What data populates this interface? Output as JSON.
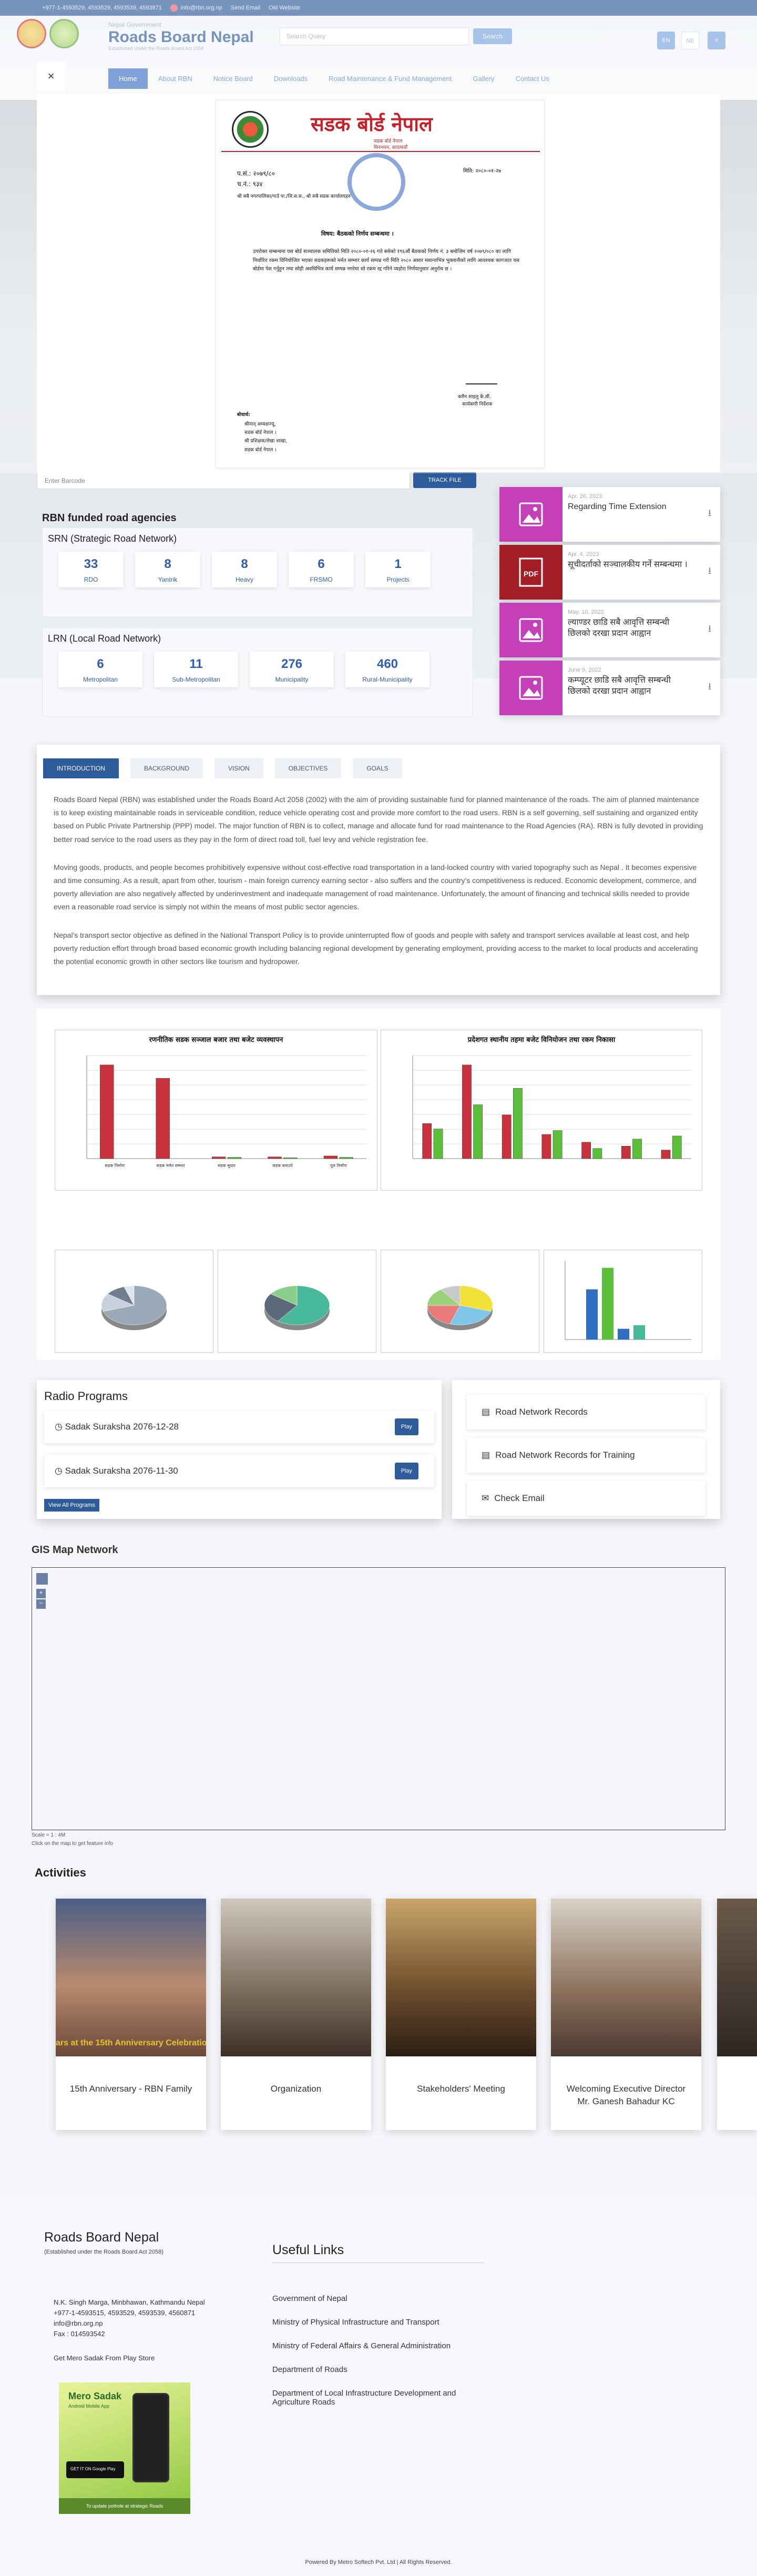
{
  "topbar": {
    "phones": "+977-1-4593529, 4593529, 4593539, 4593871",
    "email": "info@rbn.org.np",
    "links": [
      "Send Email",
      "Old Website"
    ]
  },
  "header": {
    "govt": "Nepal Government",
    "name": "Roads Board Nepal",
    "tagline": "Established Under the Roads Board Act 2058",
    "search_placeholder": "Search Query",
    "search_btn": "Search",
    "lang": [
      "EN",
      "NE"
    ],
    "nav": [
      "Home",
      "About RBN",
      "Notice Board",
      "Downloads",
      "Road Maintenance & Fund Management",
      "Gallery",
      "Contact Us"
    ]
  },
  "modal": {
    "close": "×",
    "letter": {
      "title": "सडक बोर्ड नेपाल",
      "subtitle": "सडक बोर्ड नेपाल",
      "address": "मिनभवन, काठमाडौं",
      "pa_sa": "प.सं.: २०७९/८०",
      "cha_no": "च.नं.: ९३४",
      "date": "मिति: २०८०-०१-२७",
      "to": "श्री सबै नगरपालिका/गाउँ पा./जि.स.स., श्री सबै सडक कार्यालयहरु",
      "subject": "विषय: बैठकको निर्णय सम्बन्धमा ।",
      "body": "उपरोक्त सम्बन्धमा यस बोर्ड सञ्चालक समितिको मिति २०८०-०१-२६ गते बसेको १९६औं बैठकको निर्णय नं. ३ बमोजिम वर्ष २०७९/०८० का लागि निर्धारित रकम विनियोजित भएका सडकहरूको मर्मत सम्भार कार्य सम्पन्न गरी मिति २०८० असार मसान्तभित्र भुक्तानीको लागि आवश्यक कागजात यस बोर्डमा पेश गर्नुहुन तथा सोही अवधिभित्र कार्य सम्पन्न नगरेमा सो रकम रद्द गरिने व्यहोरा निर्णयानुसार अनुरोध छ ।",
      "sign_name": "कमैन साइलु के.सी.",
      "sign_title": "कार्यकारी निर्देशक",
      "cc_title": "बोधार्थ:",
      "cc": [
        "श्रीमान् अध्यक्षज्यू,",
        "सडक बोर्ड नेपाल ।",
        "श्री प्रशिक्षक/लेखा शाखा,",
        "सडक बोर्ड नेपाल ।"
      ]
    }
  },
  "barcode": {
    "placeholder": "Enter Barcode",
    "btn": "TRACK FILE"
  },
  "funded": {
    "title": "RBN funded road agencies",
    "srn": {
      "title": "SRN (Strategic Road Network)",
      "tiles": [
        {
          "num": "33",
          "lbl": "RDO"
        },
        {
          "num": "8",
          "lbl": "Yantrik"
        },
        {
          "num": "8",
          "lbl": "Heavy"
        },
        {
          "num": "6",
          "lbl": "FRSMO"
        },
        {
          "num": "1",
          "lbl": "Projects"
        }
      ]
    },
    "lrn": {
      "title": "LRN (Local Road Network)",
      "tiles": [
        {
          "num": "6",
          "lbl": "Metropolitan"
        },
        {
          "num": "11",
          "lbl": "Sub-Metropolitan"
        },
        {
          "num": "276",
          "lbl": "Municipality"
        },
        {
          "num": "460",
          "lbl": "Rural-Municipality"
        }
      ]
    }
  },
  "notices": [
    {
      "date": "Apr. 26, 2023",
      "title": "Regarding Time Extension",
      "type": "image"
    },
    {
      "date": "Apr. 4, 2023",
      "title": "सूचीदर्ताको सञ्चालकीय गर्ने सम्बन्धमा ।",
      "type": "pdf"
    },
    {
      "date": "May. 10, 2022",
      "title": "ल्याण्डर छाडि सबै आवृत्ति सम्बन्धी छिलको दरखा प्रदान आह्वान",
      "type": "image"
    },
    {
      "date": "June 9, 2022",
      "title": "कम्प्यूटर छाडि सबै आवृत्ति सम्बन्धी छिलको दरखा प्रदान आह्वान",
      "type": "image"
    }
  ],
  "about": {
    "tabs": [
      "INTRODUCTION",
      "BACKGROUND",
      "VISION",
      "OBJECTIVES",
      "GOALS"
    ],
    "paragraphs": [
      "Roads Board Nepal (RBN) was established under the Roads Board Act 2058 (2002) with the aim of providing sustainable fund for planned maintenance of the roads. The aim of planned maintenance is to keep existing maintainable roads in serviceable condition, reduce vehicle operating cost and provide more comfort to the road users. RBN is a self governing, self sustaining and organized entity based on Public Private Partnership (PPP) model. The major function of RBN is to collect, manage and allocate fund for road maintenance to the Road Agencies (RA). RBN is fully devoted in providing better road service to the road users as they pay in the form of direct road toll, fuel levy and vehicle registration fee.",
      "Moving goods, products, and people becomes prohibitively expensive without cost-effective road transportation in a land-locked country with varied topography such as Nepal . It becomes expensive and time consuming. As a result, apart from other, tourism - main foreign currency earning sector - also suffers and the country's competitiveness is reduced. Economic development, commerce, and poverty alleviation are also negatively affected by underinvestment and inadequate management of road maintenance. Unfortunately, the amount of financing and technical skills needed to provide even a reasonable road service is simply not within the means of most public sector agencies.",
      "Nepal's transport sector objective as defined in the National Transport Policy is to provide uninterrupted flow of goods and people with safety and transport services available at least cost, and help poverty reduction effort through broad based economic growth including balancing regional development by generating employment, providing access to the market to local products and accelerating the potential economic growth in other sectors like tourism and hydropower."
    ]
  },
  "chart_data": [
    {
      "type": "bar",
      "title": "रणनीतिक सडक सञ्जाल बजार तथा बजेट व्यवस्थापन",
      "ylabel": "",
      "categories": [
        "सडक निर्माण",
        "सडक मर्मत सम्भार",
        "सडक सुधार",
        "सडक बनाउने",
        "पुल निर्माण"
      ],
      "series": [
        {
          "name": "",
          "values": [
            210,
            180,
            4,
            4,
            6
          ]
        },
        {
          "name": "",
          "values": [
            0,
            0,
            3,
            2,
            3
          ]
        }
      ]
    },
    {
      "type": "bar",
      "title": "प्रदेशगत स्थानीय तहमा बजेट विनियोजन तथा रकम निकासा",
      "ylabel": "",
      "categories": [
        "",
        "",
        "",
        "",
        "",
        "",
        ""
      ],
      "series": [
        {
          "name": "",
          "values": [
            450,
            1200,
            560,
            310,
            210,
            160,
            110
          ]
        },
        {
          "name": "",
          "values": [
            380,
            690,
            900,
            360,
            130,
            250,
            290
          ]
        }
      ]
    },
    {
      "type": "pie",
      "title": "",
      "values": [
        70,
        15,
        10,
        5
      ]
    },
    {
      "type": "pie",
      "title": "",
      "values": [
        60,
        25,
        15
      ]
    },
    {
      "type": "pie",
      "title": "",
      "values": [
        30,
        25,
        20,
        15,
        10
      ]
    },
    {
      "type": "bar",
      "title": "",
      "values": [
        70,
        100,
        15,
        20
      ]
    }
  ],
  "colors": {
    "chart_red": "#c8323c",
    "chart_green": "#5bbf3a",
    "chart_blue": "#2e6fc4",
    "chart_teal": "#47b89a"
  },
  "radio": {
    "title": "Radio Programs",
    "items": [
      "Sadak Suraksha 2076-12-28",
      "Sadak Suraksha 2076-11-30"
    ],
    "play": "Play",
    "view_all": "View All Programs"
  },
  "quicklinks": [
    "Road Network Records",
    "Road Network Records for Training",
    "Check Email"
  ],
  "gis": {
    "title": "GIS Map Network",
    "scale": "Scale = 1 : 4M",
    "hint": "Click on the map to get feature info"
  },
  "activities": {
    "title": "Activities",
    "items": [
      "15th Anniversary - RBN Family",
      "Organization",
      "Stakeholders' Meeting",
      "Welcoming Executive Director Mr. Ganesh Bahadur KC"
    ],
    "banner_text": "ars at the 15th Anniversary Celebratio"
  },
  "footer": {
    "name": "Roads Board Nepal",
    "est": "(Established under the Roads Board Act 2058)",
    "address": "N.K. Singh Marga, Minbhawan, Kathmandu Nepal",
    "phone": "+977-1-4593515, 4593529, 4593539, 4560871",
    "email": "info@rbn.org.np",
    "fax": "Fax : 014593542",
    "app": "Get Mero Sadak From Play Store",
    "app_name": "Mero Sadak",
    "app_sub": "Android Mobile App",
    "app_store": "GET IT ON Google Play",
    "app_footer": "To update pothole at strategic Roads",
    "useful_title": "Useful Links",
    "useful": [
      "Government of Nepal",
      "Ministry of Physical Infrastructure and Transport",
      "Ministry of Federal Affairs & General Administration",
      "Department of Roads",
      "Department of Local Infrastructure Development and Agriculture Roads"
    ],
    "credit": "Powered By Metro Softech Pvt. Ltd | All Rights Reserved."
  }
}
